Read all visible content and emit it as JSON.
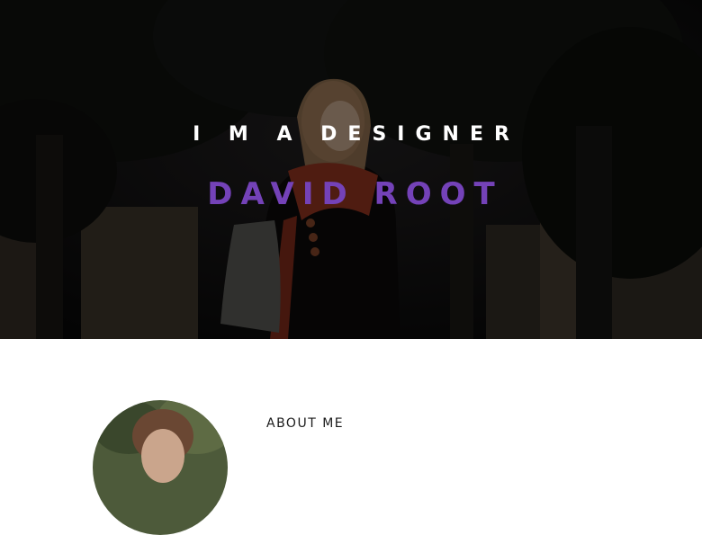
{
  "hero": {
    "tagline": "I M A DESIGNER",
    "name": "DAVID ROOT",
    "name_color": "#7442b8",
    "overlay": "dark photo of woman with backpack among trees"
  },
  "about": {
    "heading": "ABOUT ME"
  }
}
